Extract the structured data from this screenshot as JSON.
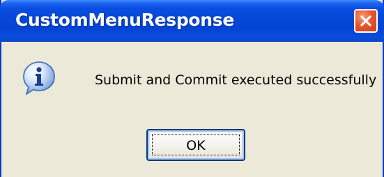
{
  "window": {
    "title": "CustomMenuResponse",
    "title_color": "#ffffff",
    "titlebar_color": "#0547d8",
    "body_color": "#ece9d8"
  },
  "titlebar": {
    "close_icon": "close-icon",
    "close_color": "#e8562c"
  },
  "dialog": {
    "icon": "info-icon",
    "message": "Submit and Commit executed successfully"
  },
  "buttons": {
    "ok_label": "OK"
  }
}
